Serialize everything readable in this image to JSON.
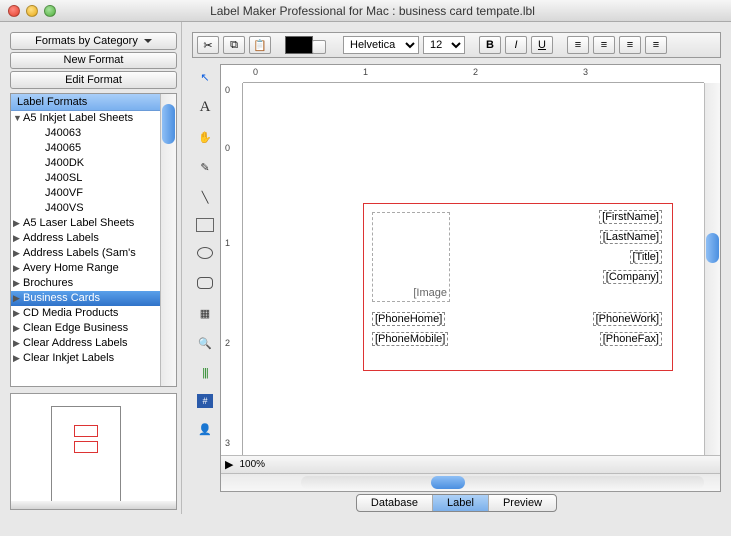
{
  "window": {
    "title": "Label Maker Professional for Mac : business card tempate.lbl"
  },
  "sidebar": {
    "buttons": {
      "category": "Formats by Category",
      "new": "New Format",
      "edit": "Edit Format"
    },
    "header": "Label Formats",
    "tree": [
      {
        "kind": "cat",
        "label": "A5 Inkjet Label Sheets",
        "open": true
      },
      {
        "kind": "leaf",
        "label": "J40063"
      },
      {
        "kind": "leaf",
        "label": "J40065"
      },
      {
        "kind": "leaf",
        "label": "J400DK"
      },
      {
        "kind": "leaf",
        "label": "J400SL"
      },
      {
        "kind": "leaf",
        "label": "J400VF"
      },
      {
        "kind": "leaf",
        "label": "J400VS"
      },
      {
        "kind": "cat",
        "label": "A5 Laser Label Sheets"
      },
      {
        "kind": "cat",
        "label": "Address Labels"
      },
      {
        "kind": "cat",
        "label": "Address Labels (Sam's"
      },
      {
        "kind": "cat",
        "label": "Avery Home Range"
      },
      {
        "kind": "cat",
        "label": "Brochures"
      },
      {
        "kind": "cat",
        "label": "Business Cards",
        "selected": true
      },
      {
        "kind": "cat",
        "label": "CD Media Products"
      },
      {
        "kind": "cat",
        "label": "Clean Edge  Business"
      },
      {
        "kind": "cat",
        "label": "Clear Address Labels"
      },
      {
        "kind": "cat",
        "label": "Clear Inkjet Labels"
      }
    ]
  },
  "toolbar": {
    "font": "Helvetica",
    "size": "12",
    "color": "#000000",
    "buttons": {
      "cut": "✂",
      "copy": "⧉",
      "paste": "📋",
      "bold": "B",
      "italic": "I",
      "underline": "U"
    }
  },
  "tools": [
    "pointer",
    "text",
    "hand",
    "pen",
    "line",
    "rect",
    "ellipse",
    "rrect",
    "image",
    "search",
    "barcode",
    "seq",
    "person"
  ],
  "ruler": {
    "h": [
      "0",
      "1",
      "2",
      "3"
    ],
    "v": [
      "0",
      "0",
      "1",
      "2",
      "3"
    ]
  },
  "card": {
    "image_label": "[Image",
    "fields_left": [
      "[PhoneHome]",
      "[PhoneMobile]"
    ],
    "fields_right_top": [
      "[FirstName]",
      "[LastName]",
      "[Title]",
      "[Company]"
    ],
    "fields_right_bottom": [
      "[PhoneWork]",
      "[PhoneFax]"
    ]
  },
  "status": {
    "zoom": "100%"
  },
  "tabs": {
    "database": "Database",
    "label": "Label",
    "preview": "Preview"
  }
}
